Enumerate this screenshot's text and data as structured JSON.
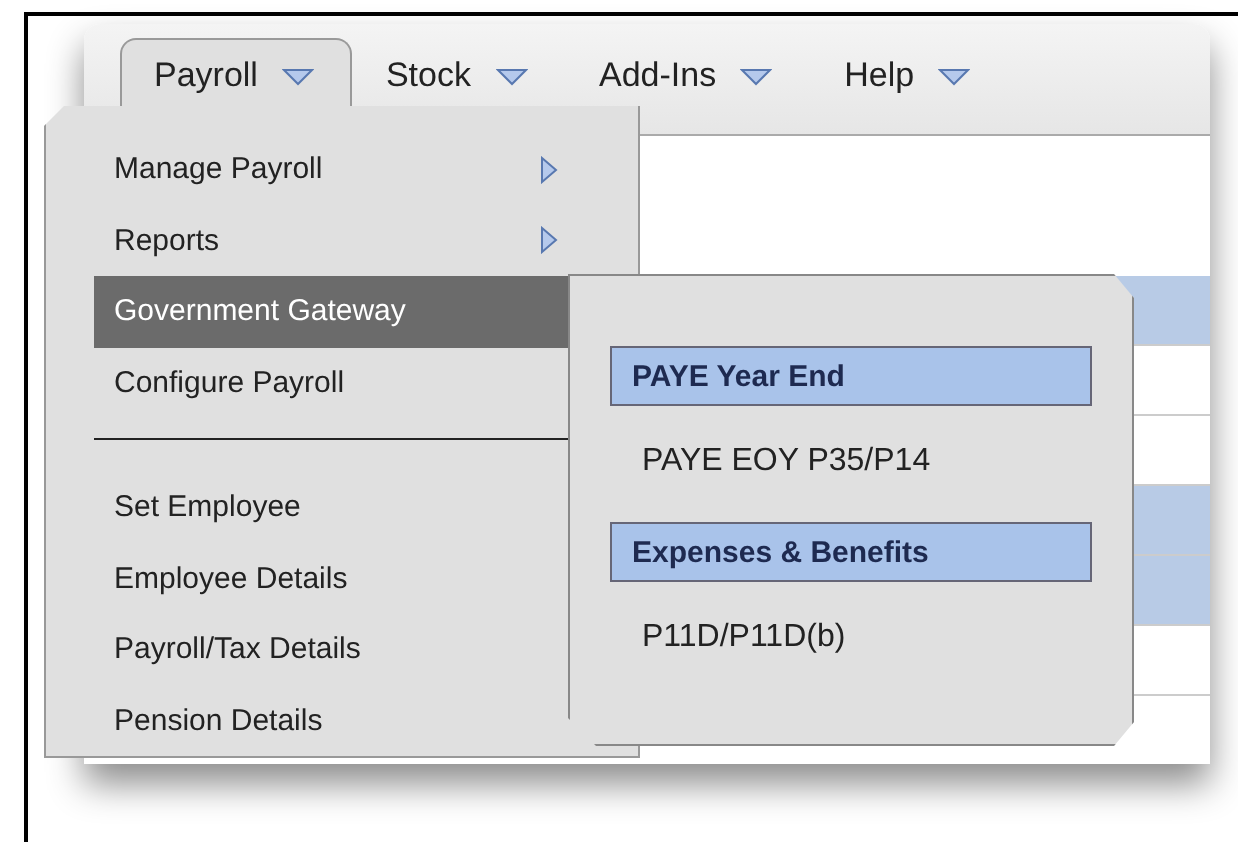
{
  "menu_bar": [
    {
      "label": "Payroll",
      "selected": true
    },
    {
      "label": "Stock",
      "selected": false
    },
    {
      "label": "Add-Ins",
      "selected": false
    },
    {
      "label": "Help",
      "selected": false
    }
  ],
  "dropdown": [
    {
      "kind": "item",
      "label": "Manage Payroll",
      "submenu": true,
      "selected": false
    },
    {
      "kind": "item",
      "label": "Reports",
      "submenu": true,
      "selected": false
    },
    {
      "kind": "item",
      "label": "Government Gateway",
      "submenu": false,
      "selected": true
    },
    {
      "kind": "item",
      "label": "Configure Payroll",
      "submenu": false,
      "selected": false
    },
    {
      "kind": "separator"
    },
    {
      "kind": "item",
      "label": "Set Employee",
      "submenu": false,
      "selected": false
    },
    {
      "kind": "item",
      "label": "Employee Details",
      "submenu": false,
      "selected": false
    },
    {
      "kind": "item",
      "label": "Payroll/Tax Details",
      "submenu": false,
      "selected": false
    },
    {
      "kind": "item",
      "label": "Pension Details",
      "submenu": false,
      "selected": false
    }
  ],
  "submenu": [
    {
      "kind": "header",
      "label": "PAYE Year End"
    },
    {
      "kind": "item",
      "label": "PAYE EOY P35/P14"
    },
    {
      "kind": "header",
      "label": "Expenses & Benefits"
    },
    {
      "kind": "item",
      "label": "P11D/P11D(b)"
    }
  ]
}
